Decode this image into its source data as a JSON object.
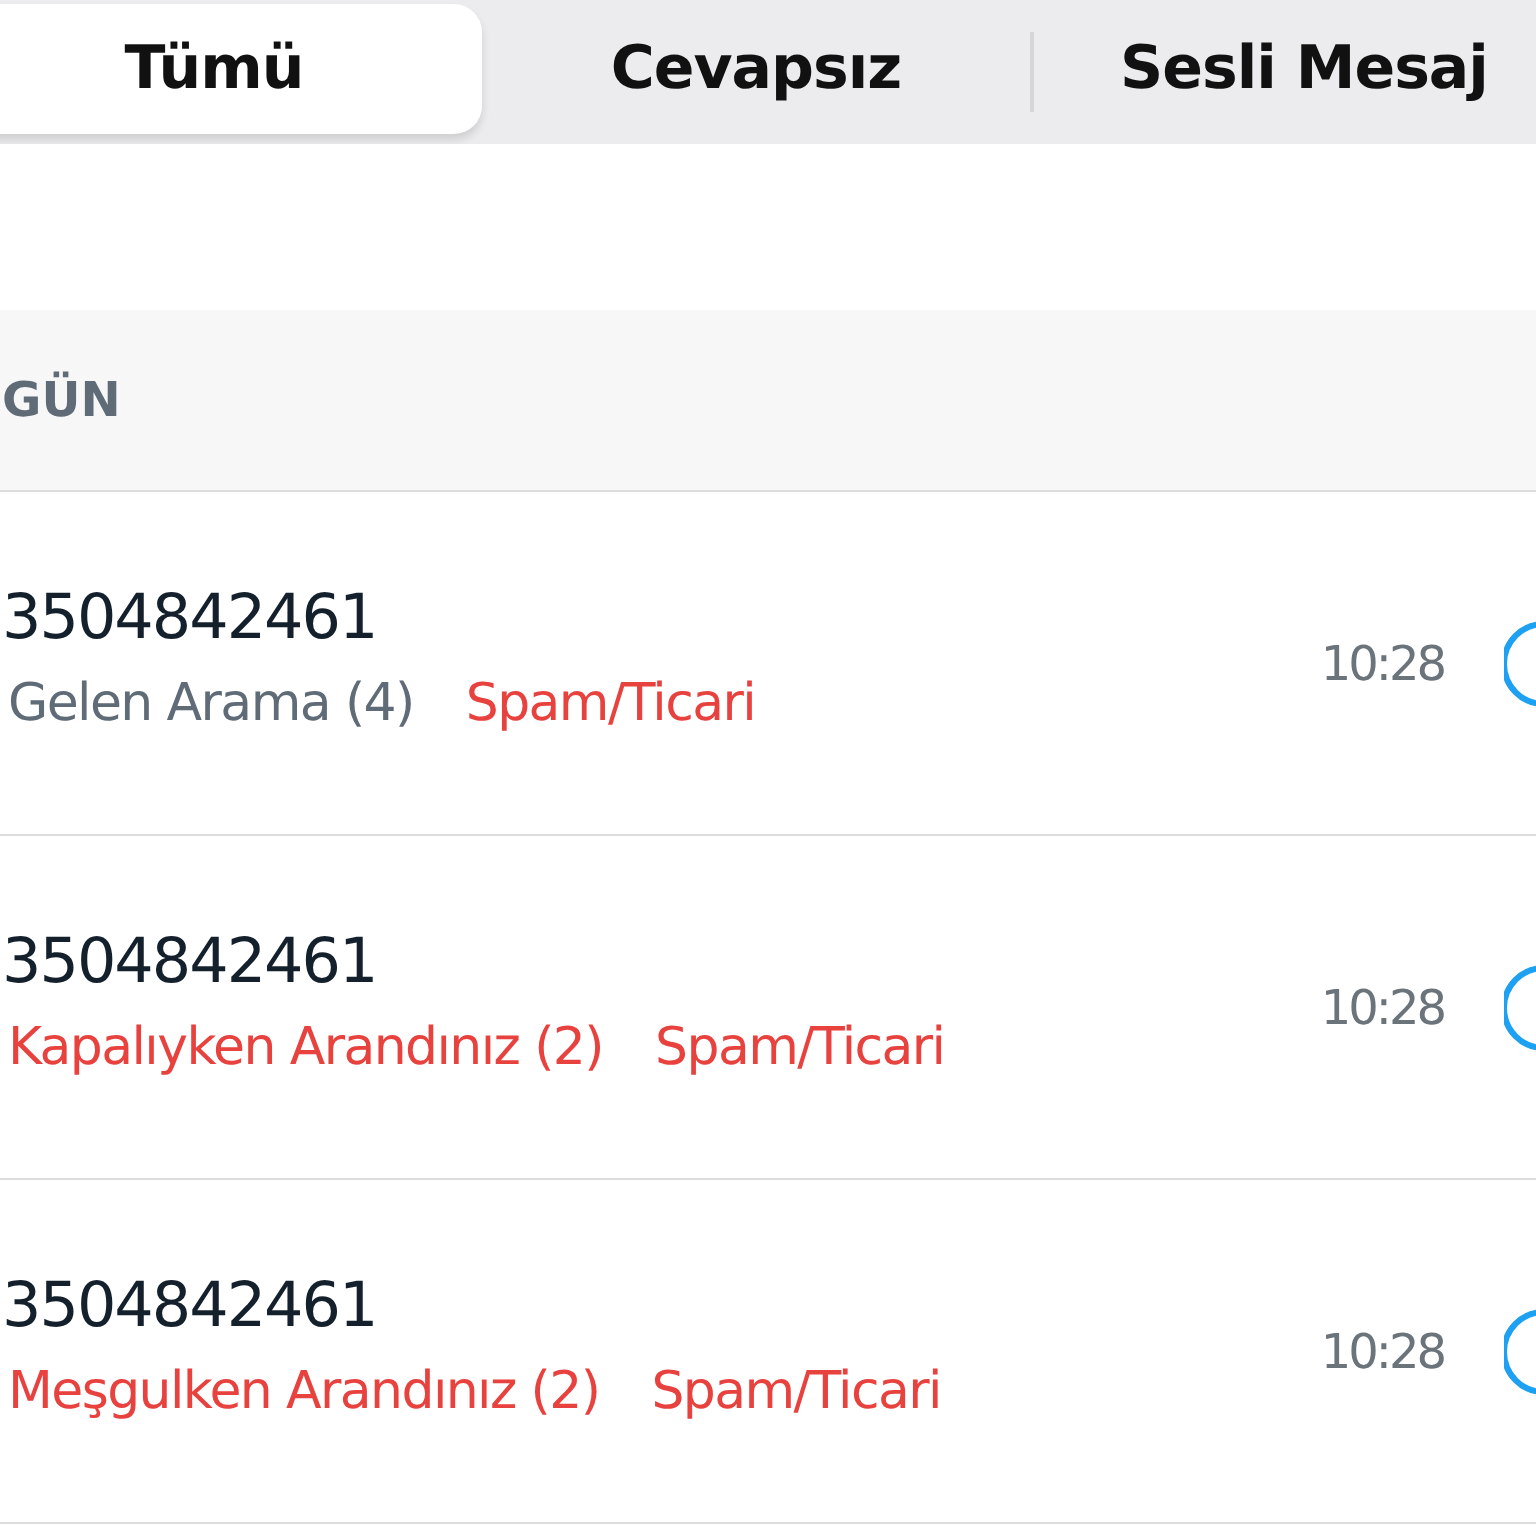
{
  "tabs": [
    {
      "label": "Tümü",
      "selected": true
    },
    {
      "label": "Cevapsız",
      "selected": false
    },
    {
      "label": "Sesli Mesaj",
      "selected": false
    }
  ],
  "section": {
    "title": "GÜN"
  },
  "calls": [
    {
      "number": "3504842461",
      "kind": "incoming",
      "status": "Gelen Arama (4)",
      "tag": "Spam/Ticari",
      "time": "10:28"
    },
    {
      "number": "3504842461",
      "kind": "missed",
      "status": "Kapalıyken Arandınız (2)",
      "tag": "Spam/Ticari",
      "time": "10:28"
    },
    {
      "number": "3504842461",
      "kind": "missed",
      "status": "Meşgulken Arandınız (2)",
      "tag": "Spam/Ticari",
      "time": "10:28"
    }
  ]
}
